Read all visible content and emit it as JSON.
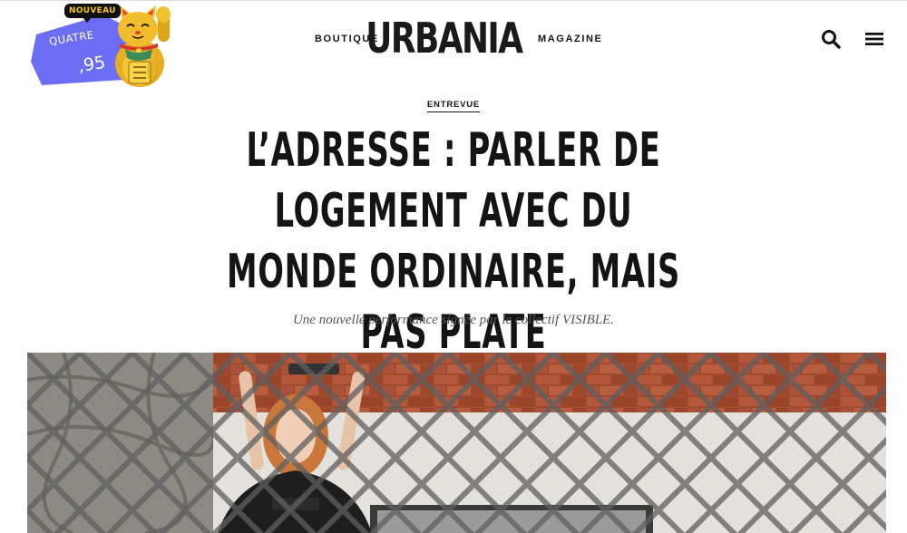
{
  "header": {
    "logo_text": "URBANIA",
    "nav_left_label": "BOUTIQUE",
    "nav_right_label": "MAGAZINE",
    "search_icon": "search-icon",
    "menu_icon": "hamburger-menu-icon"
  },
  "promo": {
    "badge_label": "NOUVEAU",
    "line1": "QUATRE",
    "price": ",95",
    "blob_color": "#6b6ef2",
    "illustration": "lucky-cat-icon"
  },
  "article": {
    "category": "ENTREVUE",
    "title": "L’ADRESSE : PARLER DE LOGEMENT AVEC DU MONDE ORDINAIRE, MAIS PAS PLATE",
    "subtitle": "Une nouvelle performance signée par le collectif VISIBLE."
  }
}
